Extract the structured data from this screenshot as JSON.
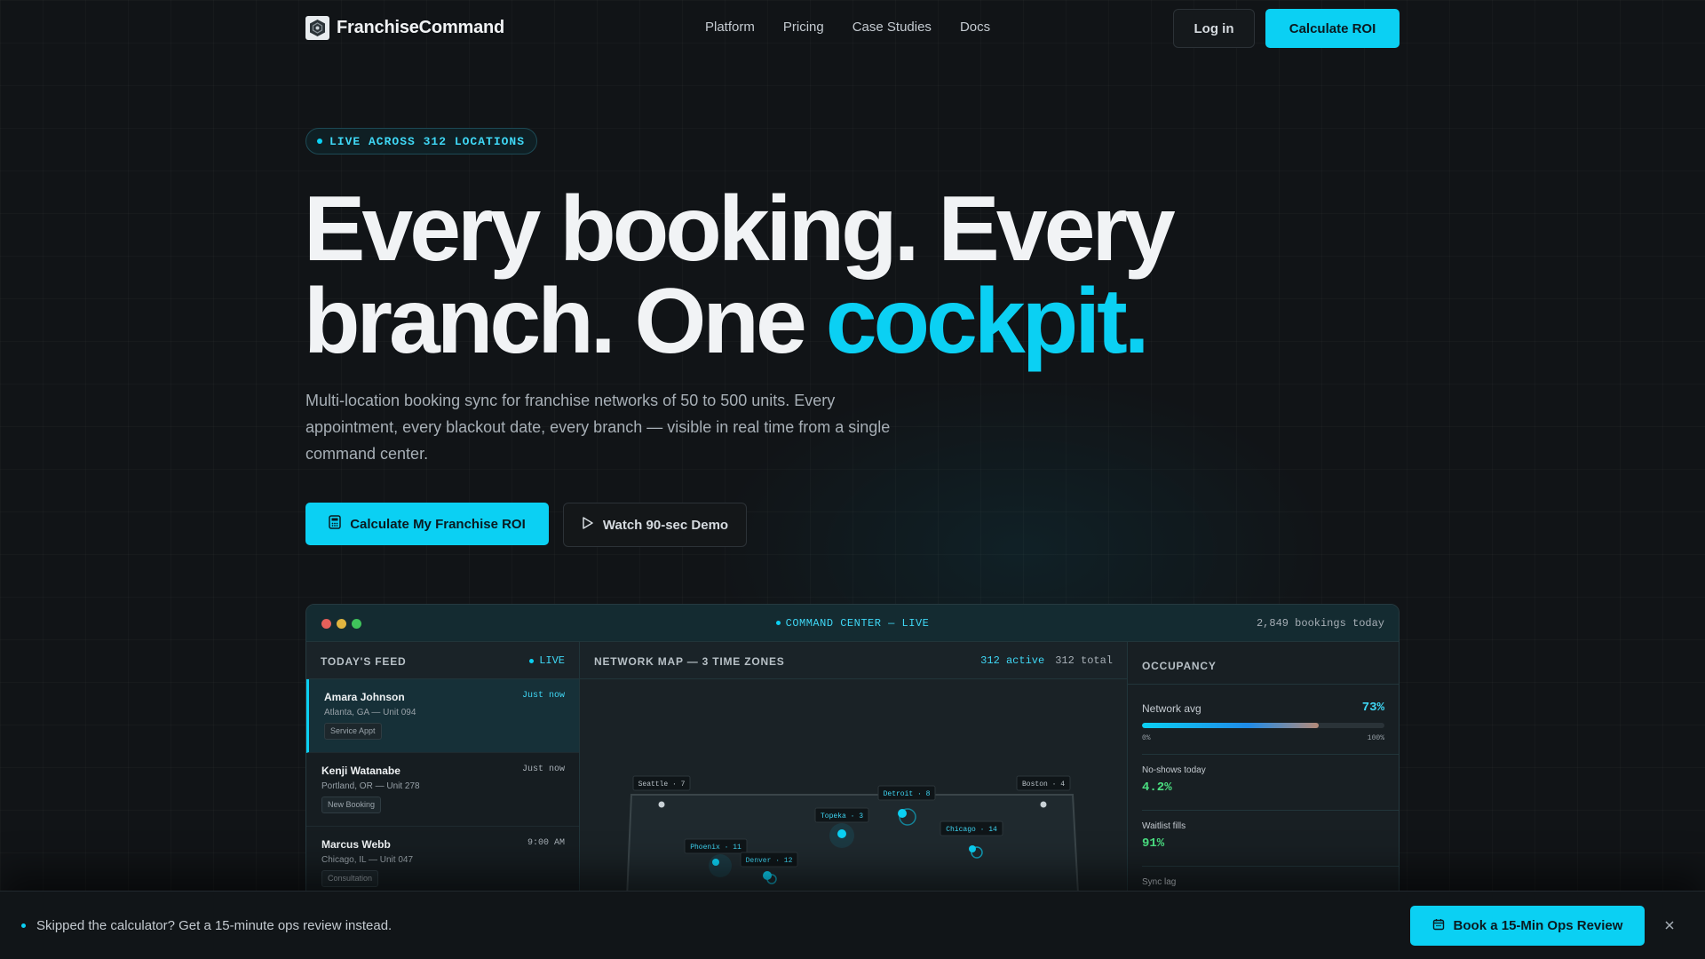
{
  "brand": {
    "name": "FranchiseCommand"
  },
  "nav": {
    "links": [
      "Platform",
      "Pricing",
      "Case Studies",
      "Docs"
    ],
    "login_label": "Log in",
    "cta_label": "Calculate ROI"
  },
  "hero": {
    "badge": "LIVE ACROSS 312 LOCATIONS",
    "headline_line1": "Every booking. Every",
    "headline_line2_plain": "branch. One ",
    "headline_line2_accent": "cockpit.",
    "subcopy": "Multi-location booking sync for franchise networks of 50 to 500 units. Every appointment, every blackout date, every branch — visible in real time from a single command center.",
    "primary_cta": "Calculate My Franchise ROI",
    "secondary_cta": "Watch 90-sec Demo"
  },
  "dashboard": {
    "title": "COMMAND CENTER — LIVE",
    "bookings_today": "2,849 bookings today",
    "feed": {
      "title": "TODAY'S FEED",
      "live_label": "LIVE",
      "items": [
        {
          "name": "Amara Johnson",
          "time": "Just now",
          "location": "Atlanta, GA — Unit 094",
          "tag": "Service Appt"
        },
        {
          "name": "Kenji Watanabe",
          "time": "Just now",
          "location": "Portland, OR — Unit 278",
          "tag": "New Booking"
        },
        {
          "name": "Marcus Webb",
          "time": "9:00 AM",
          "location": "Chicago, IL — Unit 047",
          "tag": "Consultation"
        }
      ]
    },
    "map": {
      "title": "NETWORK MAP — 3 TIME ZONES",
      "active": "312 active",
      "total": "312 total",
      "markers": [
        "Seattle · 7",
        "Detroit · 8",
        "Boston · 4",
        "Topeka · 3",
        "Chicago · 14",
        "Phoenix · 11",
        "Denver · 12"
      ]
    },
    "occupancy": {
      "title": "OCCUPANCY",
      "network_avg_label": "Network avg",
      "network_avg_value": "73%",
      "network_avg_fraction": 0.73,
      "scale_min": "0%",
      "scale_max": "100%",
      "noshows_label": "No-shows today",
      "noshows_value": "4.2%",
      "waitlist_label": "Waitlist fills",
      "waitlist_value": "91%",
      "synclag_label": "Sync lag"
    }
  },
  "banner": {
    "text": "Skipped the calculator? Get a 15-minute ops review instead.",
    "cta": "Book a 15-Min Ops Review"
  },
  "colors": {
    "accent": "#0bd0f3",
    "positive": "#4ade80",
    "background": "#111417"
  }
}
